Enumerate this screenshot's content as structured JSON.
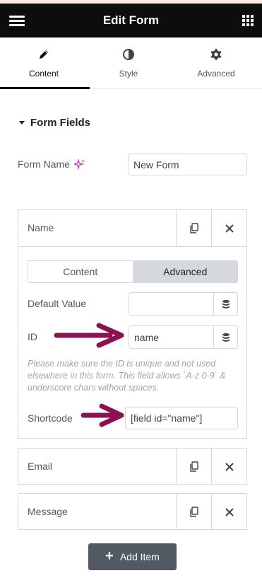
{
  "header": {
    "title": "Edit Form",
    "menu_icon": "hamburger-icon",
    "grid_icon": "apps-grid-icon"
  },
  "tabs": [
    {
      "label": "Content",
      "icon": "pencil-icon",
      "active": true
    },
    {
      "label": "Style",
      "icon": "half-circle-icon",
      "active": false
    },
    {
      "label": "Advanced",
      "icon": "gear-icon",
      "active": false
    }
  ],
  "section": {
    "title": "Form Fields"
  },
  "form_name": {
    "label": "Form Name",
    "value": "New Form",
    "ai_icon": "sparkle-icon"
  },
  "repeater": {
    "items": [
      {
        "title": "Name",
        "expanded": true
      },
      {
        "title": "Email",
        "expanded": false
      },
      {
        "title": "Message",
        "expanded": false
      }
    ],
    "inner_tabs": {
      "content": "Content",
      "advanced": "Advanced",
      "active": "Advanced"
    },
    "default_value": {
      "label": "Default Value",
      "value": ""
    },
    "id_field": {
      "label": "ID",
      "value": "name"
    },
    "note": "Please make sure the ID is unique and not used elsewhere in this form. This field allows `A-z 0-9` & underscore chars without spaces.",
    "shortcode": {
      "label": "Shortcode",
      "value": "[field id=\"name\"]"
    }
  },
  "add_button": {
    "label": "Add Item"
  },
  "colors": {
    "header_bg": "#0c0d0e",
    "annotation_arrow": "#8b1250",
    "add_button_bg": "#515962",
    "ai_sparkle": "#c036b8"
  }
}
